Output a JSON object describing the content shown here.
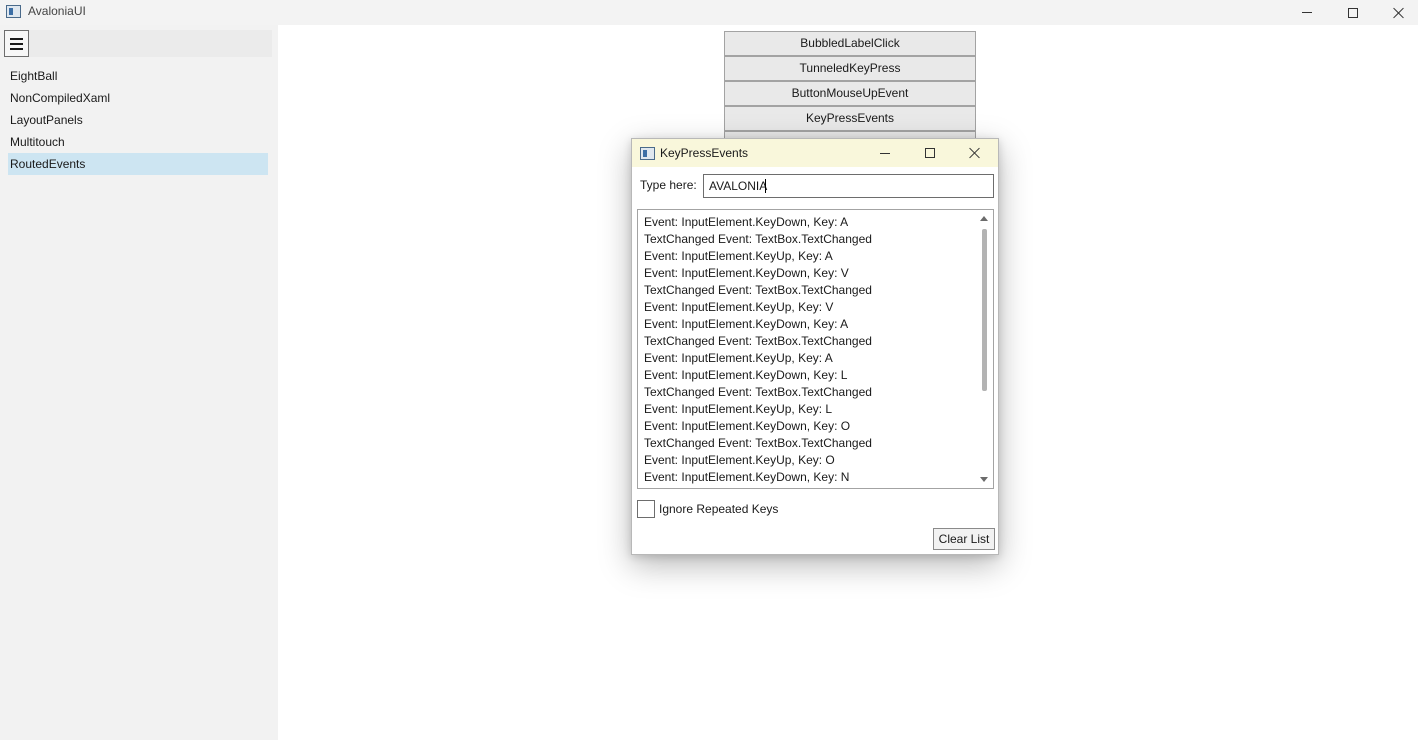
{
  "window": {
    "title": "AvaloniaUI"
  },
  "sidebar": {
    "items": [
      {
        "label": "EightBall"
      },
      {
        "label": "NonCompiledXaml"
      },
      {
        "label": "LayoutPanels"
      },
      {
        "label": "Multitouch"
      },
      {
        "label": "RoutedEvents",
        "selected": true
      }
    ]
  },
  "main": {
    "buttons": [
      {
        "label": "BubbledLabelClick"
      },
      {
        "label": "TunneledKeyPress"
      },
      {
        "label": "ButtonMouseUpEvent"
      },
      {
        "label": "KeyPressEvents"
      }
    ]
  },
  "dialog": {
    "title": "KeyPressEvents",
    "type_label": "Type here:",
    "input_value": "AVALONIA",
    "events": [
      "Event: InputElement.KeyDown, Key: A",
      "TextChanged Event: TextBox.TextChanged",
      "Event: InputElement.KeyUp, Key: A",
      "Event: InputElement.KeyDown, Key: V",
      "TextChanged Event: TextBox.TextChanged",
      "Event: InputElement.KeyUp, Key: V",
      "Event: InputElement.KeyDown, Key: A",
      "TextChanged Event: TextBox.TextChanged",
      "Event: InputElement.KeyUp, Key: A",
      "Event: InputElement.KeyDown, Key: L",
      "TextChanged Event: TextBox.TextChanged",
      "Event: InputElement.KeyUp, Key: L",
      "Event: InputElement.KeyDown, Key: O",
      "TextChanged Event: TextBox.TextChanged",
      "Event: InputElement.KeyUp, Key: O",
      "Event: InputElement.KeyDown, Key: N"
    ],
    "checkbox_label": "Ignore Repeated Keys",
    "checkbox_checked": false,
    "clear_label": "Clear List"
  },
  "colors": {
    "dialog_titlebar": "#f9f7db",
    "selected_item": "#cde5f2",
    "sidebar_bg": "#f2f2f2"
  }
}
